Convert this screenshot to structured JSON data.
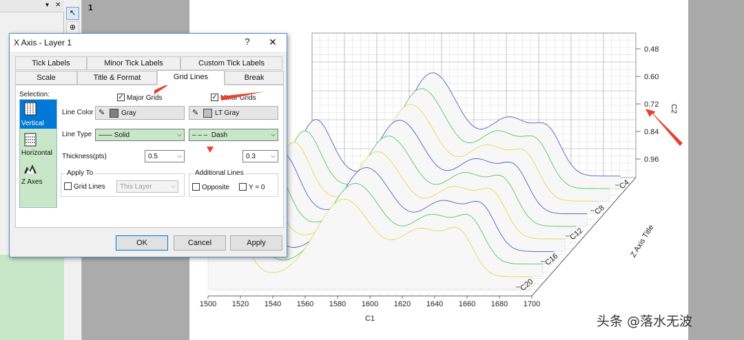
{
  "app": {
    "window_number": "1",
    "watermark": "头条 @落水无波"
  },
  "dialog": {
    "title": "X Axis - Layer 1",
    "help": "?",
    "close": "✕",
    "tabs_row1": [
      "Tick Labels",
      "Minor Tick Labels",
      "Custom Tick Labels"
    ],
    "tabs_row2": [
      "Scale",
      "Title & Format",
      "Grid Lines",
      "Break"
    ],
    "active_tab": "Grid Lines",
    "selection_label": "Selection:",
    "selection_items": [
      "Vertical",
      "Horizontal",
      "Z Axes"
    ],
    "major_grids_label": "Major Grids",
    "minor_grids_label": "Minor Grids",
    "line_color_label": "Line Color",
    "major_color": "Gray",
    "minor_color": "LT Gray",
    "major_color_hex": "#808080",
    "minor_color_hex": "#c0c0c0",
    "line_type_label": "Line Type",
    "major_line_type": "Solid",
    "minor_line_type": "Dash",
    "thickness_label": "Thickness(pts)",
    "major_thickness": "0.5",
    "minor_thickness": "0.3",
    "apply_to_label": "Apply To",
    "grid_lines_label": "Grid Lines",
    "this_layer_placeholder": "This Layer",
    "additional_lines_label": "Additional Lines",
    "opposite_label": "Opposite",
    "y0_label": "Y = 0",
    "ok_label": "OK",
    "cancel_label": "Cancel",
    "apply_label": "Apply"
  },
  "chart_data": {
    "type": "area",
    "xlabel": "C1",
    "ylabel": "C2",
    "zlabel": "Z Axis Title",
    "x_ticks": [
      "1500",
      "1520",
      "1540",
      "1560",
      "1580",
      "1600",
      "1620",
      "1640",
      "1660",
      "1680",
      "1700"
    ],
    "y_ticks": [
      "0.48",
      "0.60",
      "0.72",
      "0.84",
      "0.96"
    ],
    "z_ticks": [
      "C4",
      "C8",
      "C12",
      "C16",
      "C20"
    ]
  }
}
